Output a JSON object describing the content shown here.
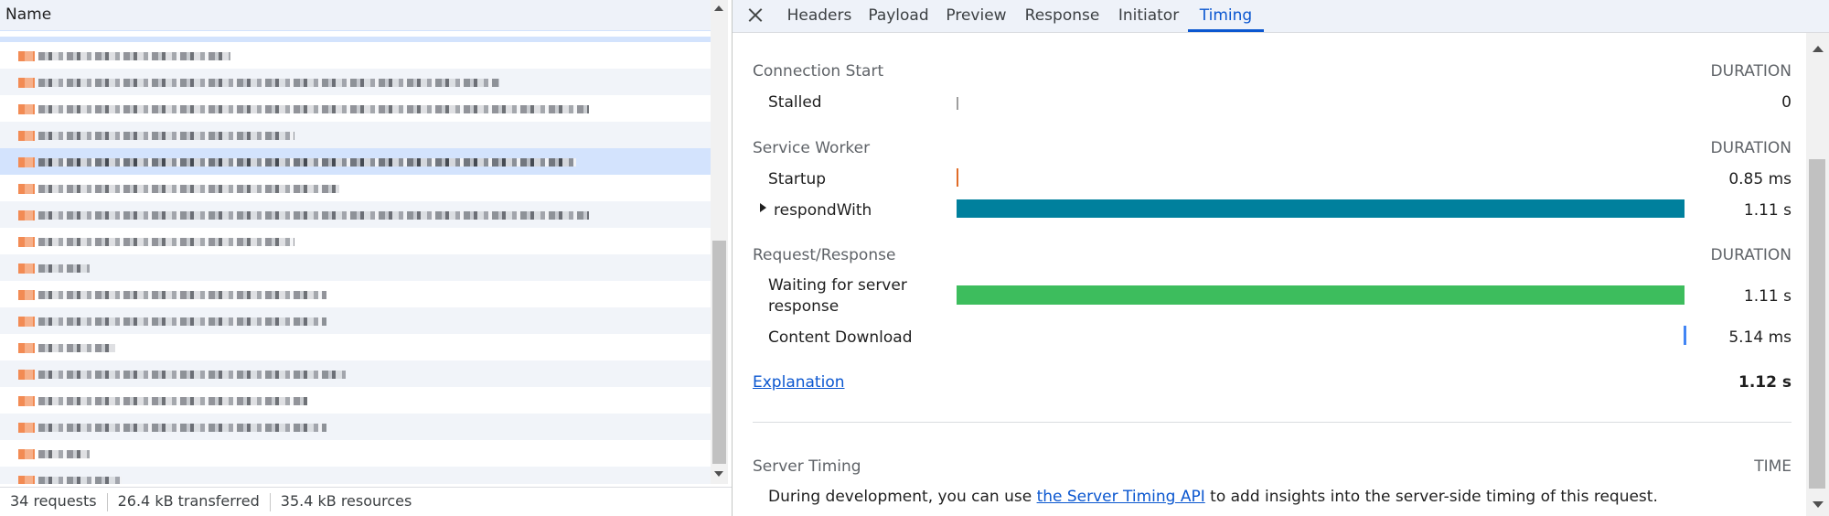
{
  "request_list": {
    "column_header": "Name",
    "rows": [
      {
        "blur_width": 0.3,
        "style": "plain"
      },
      {
        "blur_width": 0.72,
        "style": "alt"
      },
      {
        "blur_width": 0.86,
        "style": "plain"
      },
      {
        "blur_width": 0.4,
        "style": "alt"
      },
      {
        "blur_width": 0.84,
        "style": "selected"
      },
      {
        "blur_width": 0.47,
        "style": "plain"
      },
      {
        "blur_width": 0.86,
        "style": "alt"
      },
      {
        "blur_width": 0.4,
        "style": "plain"
      },
      {
        "blur_width": 0.08,
        "style": "alt"
      },
      {
        "blur_width": 0.45,
        "style": "plain"
      },
      {
        "blur_width": 0.45,
        "style": "alt"
      },
      {
        "blur_width": 0.12,
        "style": "plain"
      },
      {
        "blur_width": 0.48,
        "style": "alt"
      },
      {
        "blur_width": 0.42,
        "style": "plain"
      },
      {
        "blur_width": 0.45,
        "style": "alt"
      },
      {
        "blur_width": 0.08,
        "style": "plain"
      },
      {
        "blur_width": 0.13,
        "style": "alt"
      }
    ]
  },
  "status": {
    "requests": "34 requests",
    "transferred": "26.4 kB transferred",
    "resources": "35.4 kB resources"
  },
  "tabs": [
    {
      "label": "Headers",
      "active": false
    },
    {
      "label": "Payload",
      "active": false
    },
    {
      "label": "Preview",
      "active": false
    },
    {
      "label": "Response",
      "active": false
    },
    {
      "label": "Initiator",
      "active": false
    },
    {
      "label": "Timing",
      "active": true
    }
  ],
  "timing": {
    "connection_start": {
      "title": "Connection Start",
      "right": "DURATION",
      "stalled_label": "Stalled",
      "stalled_value": "0"
    },
    "service_worker": {
      "title": "Service Worker",
      "right": "DURATION",
      "startup_label": "Startup",
      "startup_value": "0.85 ms",
      "respond_label": "respondWith",
      "respond_value": "1.11 s"
    },
    "request_response": {
      "title": "Request/Response",
      "right": "DURATION",
      "waiting_label_line1": "Waiting for server",
      "waiting_label_line2": "response",
      "waiting_value": "1.11 s",
      "download_label": "Content Download",
      "download_value": "5.14 ms"
    },
    "explanation_link": "Explanation",
    "total": "1.12 s",
    "server_timing": {
      "title": "Server Timing",
      "right": "TIME",
      "desc_before": "During development, you can use ",
      "desc_link": "the Server Timing API",
      "desc_after": " to add insights into the server-side timing of this request."
    }
  },
  "colors": {
    "stalled": "#9e9e9e",
    "startup": "#e06c28",
    "respond_with": "#00809d",
    "waiting": "#3dbd5d",
    "download": "#4285f4",
    "active_tab": "#0b57d0"
  }
}
